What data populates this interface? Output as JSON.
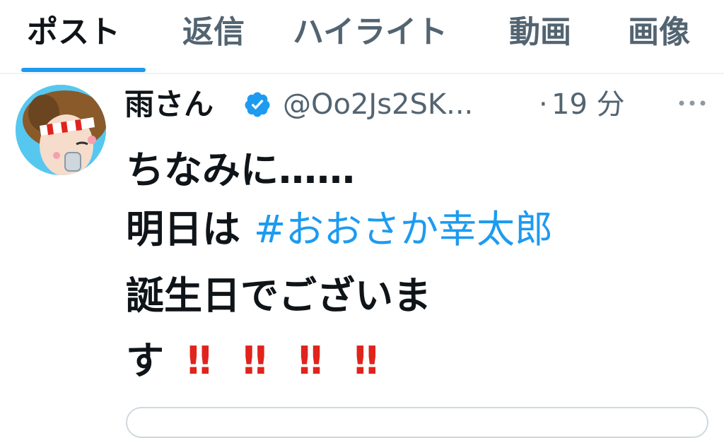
{
  "tabs": [
    {
      "label": "ポスト",
      "active": true
    },
    {
      "label": "返信",
      "active": false
    },
    {
      "label": "ハイライト",
      "active": false
    },
    {
      "label": "動画",
      "active": false
    },
    {
      "label": "画像",
      "active": false
    }
  ],
  "tweet": {
    "display_name": "雨さん",
    "verified": true,
    "handle": "@Oo2Js2SK...",
    "separator": "·",
    "time": "19 分",
    "lines": {
      "line1": "ちなみに……",
      "line2_prefix": "明日は ",
      "hashtag": "#おおさか幸太郎",
      "line3": "誕生日でございま",
      "line4_text": "す",
      "exclaims": [
        "‼",
        "‼",
        "‼",
        "‼"
      ]
    }
  },
  "colors": {
    "accent": "#1d9bf0",
    "secondary_text": "#536471",
    "primary_text": "#0f1419",
    "exclaim_red": "#e0231c"
  },
  "icons": [
    "verified-badge-icon",
    "more-options-icon",
    "avatar-image"
  ]
}
